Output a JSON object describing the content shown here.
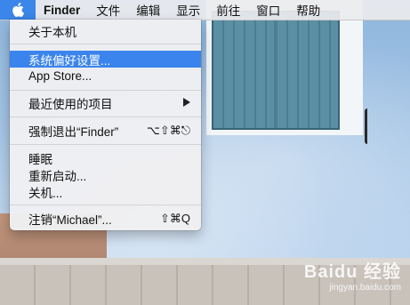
{
  "menubar": {
    "apple_icon": "apple-icon",
    "app_name": "Finder",
    "items": [
      "文件",
      "编辑",
      "显示",
      "前往",
      "窗口",
      "帮助"
    ],
    "accent_color": "#3a86ea"
  },
  "apple_menu": {
    "highlight_color": "#3b84ee",
    "items": {
      "about": "关于本机",
      "system_prefs": "系统偏好设置...",
      "app_store": "App Store...",
      "recent_items": "最近使用的项目",
      "force_quit": "强制退出“Finder”",
      "force_quit_shortcut": "⌥⇧⌘⎋",
      "sleep": "睡眠",
      "restart": "重新启动...",
      "shutdown": "关机...",
      "logout": "注销“Michael”...",
      "logout_shortcut": "⇧⌘Q"
    },
    "highlighted": "system_prefs"
  },
  "watermark": {
    "brand": "Baidu 经验",
    "url": "jingyan.baidu.com"
  }
}
